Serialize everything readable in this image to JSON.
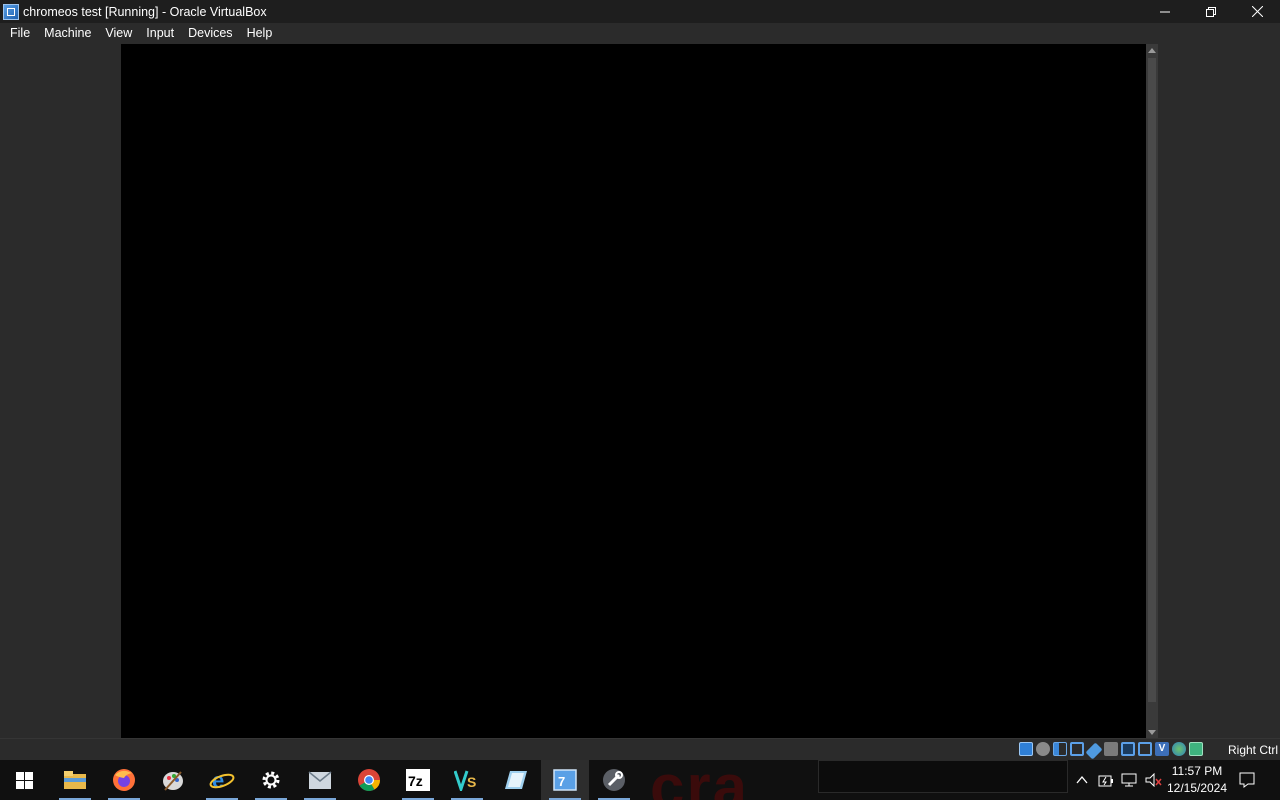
{
  "window": {
    "title": "chromeos test [Running] - Oracle VirtualBox",
    "icon": "virtualbox-icon",
    "controls": [
      "minimize-icon",
      "restore-icon",
      "close-icon"
    ]
  },
  "menubar": {
    "items": [
      "File",
      "Machine",
      "View",
      "Input",
      "Devices",
      "Help"
    ]
  },
  "vm_display": {
    "background": "#000000"
  },
  "statusbar": {
    "icons": [
      "hard-disk-icon",
      "optical-drive-icon",
      "audio-icon",
      "network-icon",
      "usb-icon",
      "shared-folders-icon",
      "display-icon",
      "video-capture-icon",
      "virtualization-icon",
      "guest-additions-icon",
      "mouse-integration-icon"
    ],
    "host_key": "Right Ctrl"
  },
  "taskbar": {
    "apps": [
      "file-explorer-icon",
      "firefox-icon",
      "paint-icon",
      "internet-explorer-icon",
      "settings-icon",
      "mail-icon",
      "chrome-icon",
      "7zip-icon",
      "visual-studio-icon",
      "notes-icon",
      "virtualbox-icon",
      "tools-icon"
    ],
    "tray": [
      "show-hidden-icons-chevron",
      "battery-icon",
      "network-icon",
      "volume-muted-icon"
    ],
    "clock": {
      "time": "11:57 PM",
      "date": "12/15/2024"
    },
    "background_text": "cra"
  }
}
